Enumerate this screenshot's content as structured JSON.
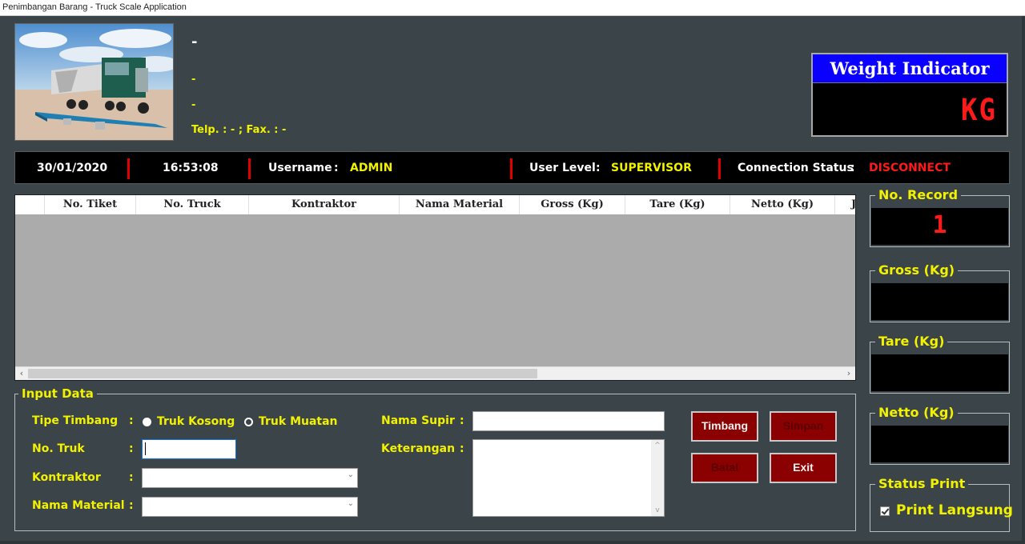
{
  "window": {
    "title": "Penimbangan Barang - Truck Scale Application"
  },
  "header": {
    "photo_alt": "truck-on-weighbridge-photo",
    "company_name": "-",
    "address_line_1": "-",
    "address_line_2": "-",
    "contact": "Telp. : - ; Fax. : -"
  },
  "weight_indicator": {
    "title": "Weight Indicator",
    "value": "",
    "unit": "KG"
  },
  "status_bar": {
    "date": "30/01/2020",
    "time": "16:53:08",
    "username_label": "Username",
    "username_value": "ADMIN",
    "user_level_label": "User Level",
    "user_level_value": "SUPERVISOR",
    "connection_label": "Connection Status",
    "connection_value": "DISCONNECT",
    "colon": ":",
    "colors": {
      "value": "#f2f200",
      "disconnect": "#ff1a1a",
      "separator": "#e00000"
    }
  },
  "grid": {
    "columns": [
      "",
      "No. Tiket",
      "No. Truck",
      "Kontraktor",
      "Nama Material",
      "Gross (Kg)",
      "Tare (Kg)",
      "Netto (Kg)",
      "J"
    ],
    "rows": [],
    "scroll_left_arrow": "‹",
    "scroll_right_arrow": "›"
  },
  "side_panels": {
    "no_record": {
      "label": "No. Record",
      "value": "1"
    },
    "gross": {
      "label": "Gross (Kg)",
      "value": ""
    },
    "tare": {
      "label": "Tare (Kg)",
      "value": ""
    },
    "netto": {
      "label": "Netto (Kg)",
      "value": ""
    },
    "status_print": {
      "label": "Status Print",
      "checkbox_label": "Print Langsung",
      "checked": true
    }
  },
  "input_data": {
    "group_label": "Input Data",
    "colon": ":",
    "tipe_timbang": {
      "label": "Tipe Timbang",
      "options": [
        {
          "label": "Truk Kosong",
          "selected": true
        },
        {
          "label": "Truk Muatan",
          "selected": false
        }
      ]
    },
    "no_truk": {
      "label": "No. Truk",
      "value": ""
    },
    "kontraktor": {
      "label": "Kontraktor",
      "value": ""
    },
    "nama_material": {
      "label": "Nama Material",
      "value": ""
    },
    "nama_supir": {
      "label": "Nama Supir",
      "value": ""
    },
    "keterangan": {
      "label": "Keterangan",
      "value": ""
    }
  },
  "buttons": {
    "timbang": {
      "label": "Timbang",
      "enabled": true
    },
    "simpan": {
      "label": "Simpan",
      "enabled": false
    },
    "batal": {
      "label": "Batal",
      "enabled": false
    },
    "exit": {
      "label": "Exit",
      "enabled": true
    }
  },
  "icons": {
    "dropdown": "⌄",
    "scroll_up": "^",
    "scroll_down": "v"
  }
}
